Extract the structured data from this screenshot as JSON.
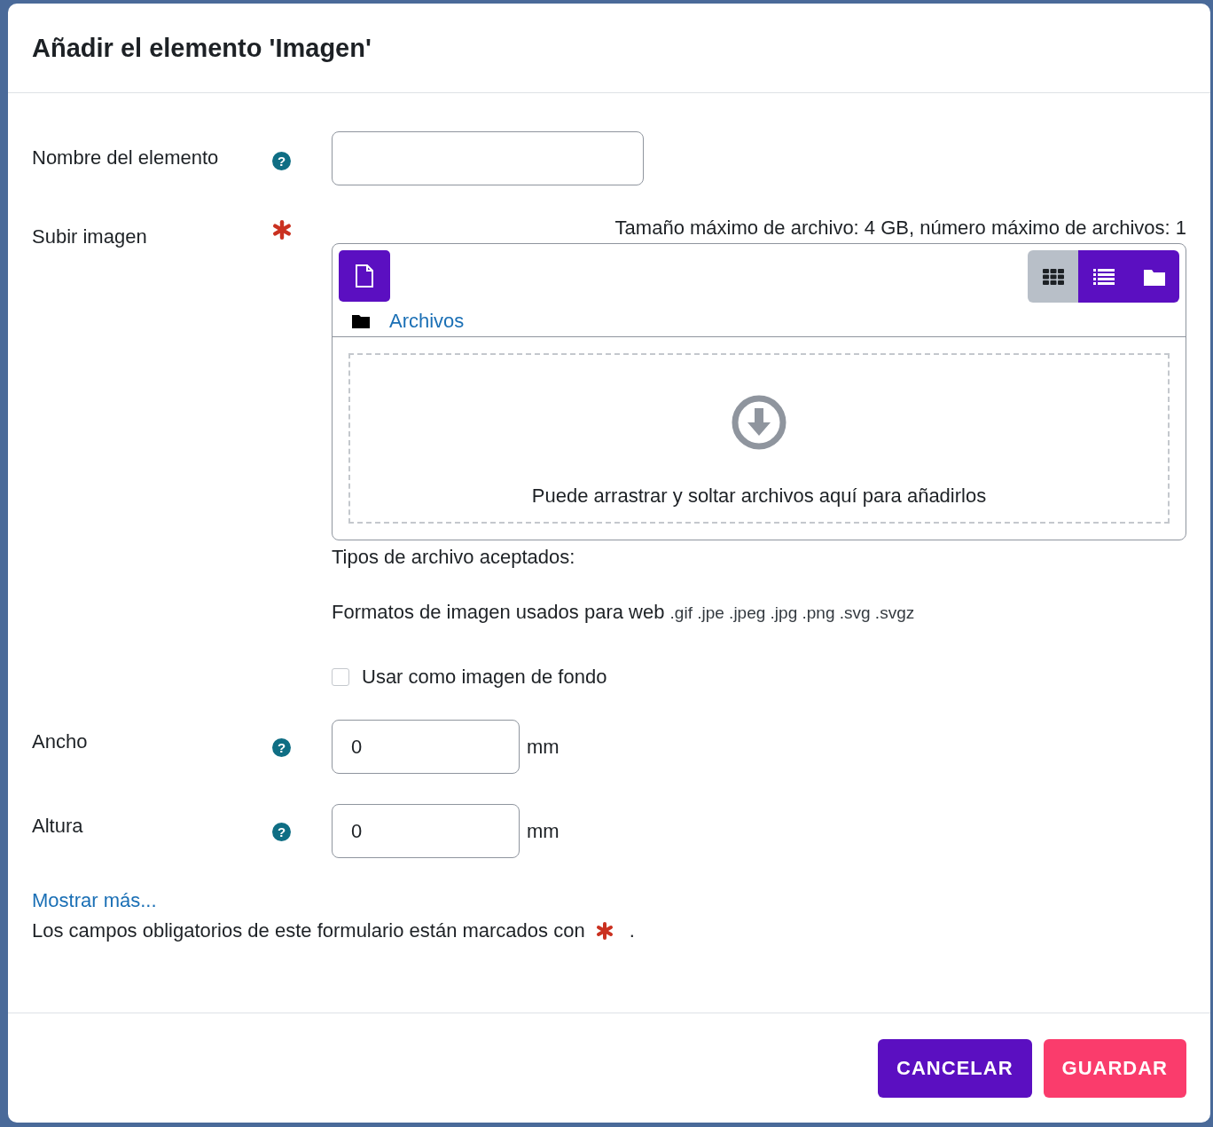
{
  "dialog": {
    "title": "Añadir el elemento 'Imagen'"
  },
  "name_field": {
    "label": "Nombre del elemento",
    "help": "?"
  },
  "upload": {
    "label": "Subir imagen",
    "required": true,
    "limits": "Tamaño máximo de archivo: 4 GB, número máximo de archivos: 1",
    "view_buttons": [
      {
        "kind": "grid",
        "selected": true
      },
      {
        "kind": "list",
        "selected": false
      },
      {
        "kind": "tree",
        "selected": false
      }
    ],
    "path": "Archivos",
    "drop_text": "Puede arrastrar y soltar archivos aquí para añadirlos",
    "accepted_label": "Tipos de archivo aceptados:",
    "accepted_group": "Formatos de imagen usados para web",
    "accepted_extensions": ".gif .jpe .jpeg .jpg .png .svg .svgz"
  },
  "background_checkbox": {
    "label": "Usar como imagen de fondo",
    "checked": false
  },
  "size_fields": [
    {
      "label": "Ancho",
      "help": "?",
      "value": "0",
      "unit": "mm"
    },
    {
      "label": "Altura",
      "help": "?",
      "value": "0",
      "unit": "mm"
    }
  ],
  "show_more": "Mostrar más...",
  "required_note": {
    "text": "Los campos obligatorios de este formulario están marcados con",
    "end": "."
  },
  "buttons": [
    {
      "kind": "secondary",
      "label": "CANCELAR"
    },
    {
      "kind": "primary",
      "label": "GUARDAR"
    }
  ]
}
